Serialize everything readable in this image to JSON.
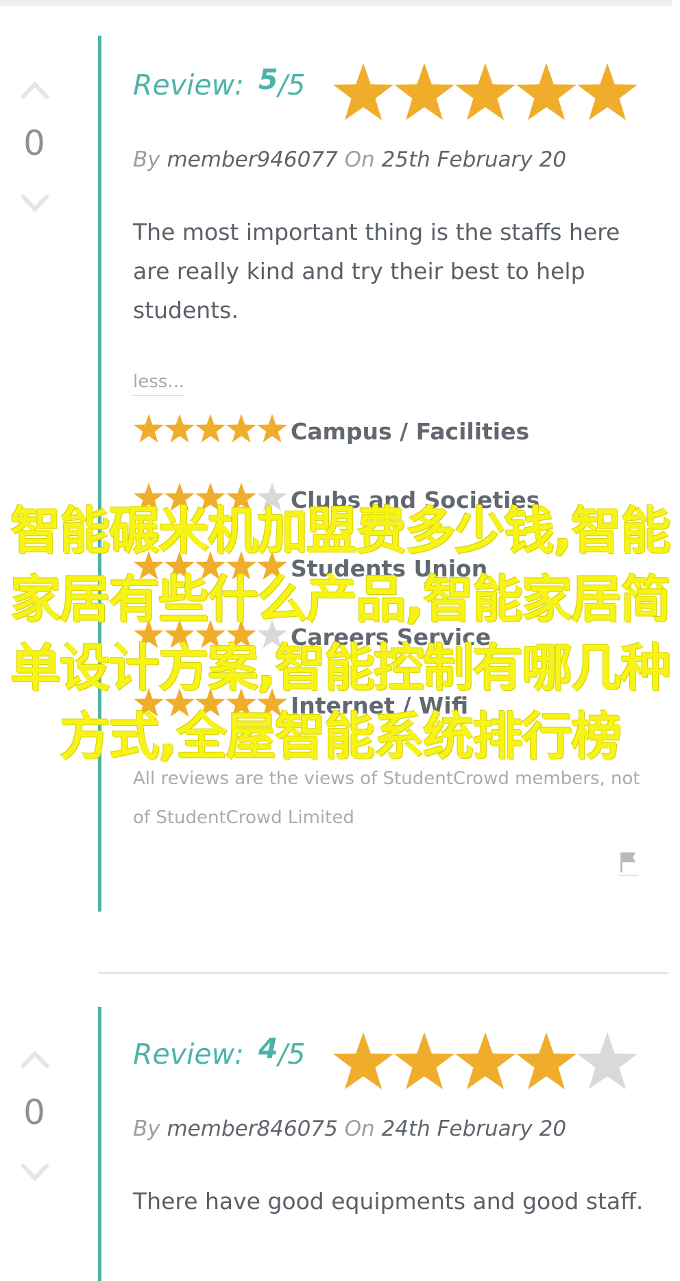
{
  "reviews": [
    {
      "votes": "0",
      "review_label": "Review:",
      "score": "5",
      "slash": "/",
      "max": "5",
      "rating": 5,
      "by_label": "By",
      "member": "member946077",
      "on_label": "On",
      "date": "25th February 20",
      "text": "The most important thing is the staffs here are really kind and try their best to help students.",
      "less_label": "less...",
      "categories": [
        {
          "label": "Campus / Facilities",
          "rating": 5
        },
        {
          "label": "Clubs and Societies",
          "rating": 4
        },
        {
          "label": "Students Union",
          "rating": 5
        },
        {
          "label": "Careers Service",
          "rating": 4
        },
        {
          "label": "Internet / Wifi",
          "rating": 5
        }
      ],
      "disclaimer": "All reviews are the views of StudentCrowd members, not of StudentCrowd Limited"
    },
    {
      "votes": "0",
      "review_label": "Review:",
      "score": "4",
      "slash": "/",
      "max": "5",
      "rating": 4,
      "by_label": "By",
      "member": "member846075",
      "on_label": "On",
      "date": "24th February 20",
      "text": "There have good equipments and good staff."
    }
  ],
  "overlay_text": "智能碾米机加盟费多少钱,智能家居有些什么产品,智能家居简单设计方案,智能控制有哪几种方式,全屋智能系统排行榜",
  "colors": {
    "accent": "#4db3a8",
    "star_filled": "#f0ad2c",
    "star_empty": "#d9d9d9",
    "overlay": "#f7f316"
  },
  "icons": {
    "upvote": "chevron-up-icon",
    "downvote": "chevron-down-icon",
    "star": "star-icon",
    "report": "flag-icon"
  }
}
